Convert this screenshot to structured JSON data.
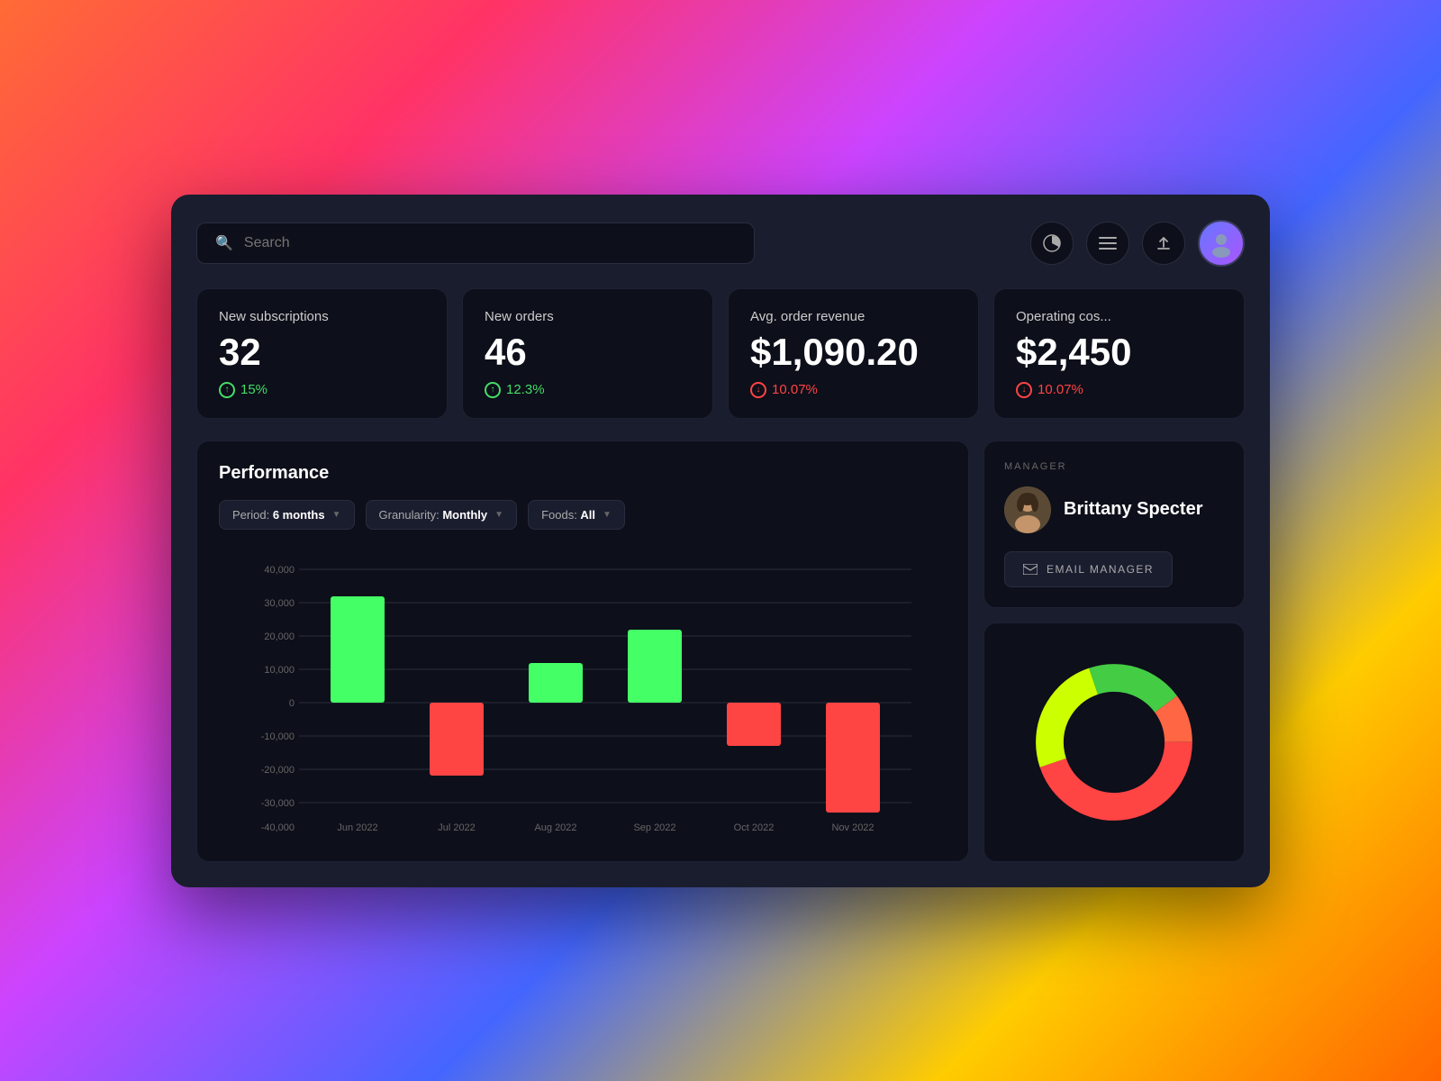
{
  "header": {
    "search_placeholder": "Search",
    "actions": [
      {
        "name": "chart-icon",
        "symbol": "◔"
      },
      {
        "name": "menu-icon",
        "symbol": "≡"
      },
      {
        "name": "upload-icon",
        "symbol": "↑"
      }
    ],
    "avatar_emoji": "👤"
  },
  "metrics": [
    {
      "label": "New subscriptions",
      "value": "32",
      "change": "15%",
      "change_type": "positive"
    },
    {
      "label": "New orders",
      "value": "46",
      "change": "12.3%",
      "change_type": "positive"
    },
    {
      "label": "Avg. order revenue",
      "value": "$1,090.20",
      "change": "10.07%",
      "change_type": "negative"
    },
    {
      "label": "Operating cos...",
      "value": "$2,450",
      "change": "10.07%",
      "change_type": "negative"
    }
  ],
  "performance": {
    "title": "Performance",
    "filters": {
      "period": {
        "label": "Period:",
        "value": "6 months"
      },
      "granularity": {
        "label": "Granularity:",
        "value": "Monthly"
      },
      "foods": {
        "label": "Foods:",
        "value": "All"
      }
    },
    "chart": {
      "y_labels": [
        "40,000",
        "30,000",
        "20,000",
        "10,000",
        "0",
        "-10,000",
        "-20,000",
        "-30,000",
        "-40,000"
      ],
      "x_labels": [
        "Jun 2022",
        "Jul 2022",
        "Aug 2022",
        "Sep 2022",
        "Oct 2022",
        "Nov 2022"
      ],
      "bars": [
        {
          "month": "Jun 2022",
          "value": 32000,
          "color": "#44ff66"
        },
        {
          "month": "Jul 2022",
          "value": -22000,
          "color": "#ff4444"
        },
        {
          "month": "Aug 2022",
          "value": 12000,
          "color": "#44ff66"
        },
        {
          "month": "Sep 2022",
          "value": 22000,
          "color": "#44ff66"
        },
        {
          "month": "Oct 2022",
          "value": -13000,
          "color": "#ff4444"
        },
        {
          "month": "Nov 2022",
          "value": -33000,
          "color": "#ff4444"
        }
      ]
    }
  },
  "manager": {
    "section_label": "MANAGER",
    "name": "Brittany Specter",
    "email_btn": "EMAIL MANAGER",
    "avatar_emoji": "🧑"
  },
  "donut": {
    "segments": [
      {
        "color": "#ff4444",
        "percent": 45
      },
      {
        "color": "#ccff00",
        "percent": 25
      },
      {
        "color": "#44cc44",
        "percent": 20
      },
      {
        "color": "#ff6644",
        "percent": 10
      }
    ]
  },
  "colors": {
    "bg": "#1a1d2e",
    "card_bg": "#0d0f1a",
    "positive": "#44dd66",
    "negative": "#ff4444",
    "accent_green": "#44ff66",
    "border": "#1e2133"
  }
}
